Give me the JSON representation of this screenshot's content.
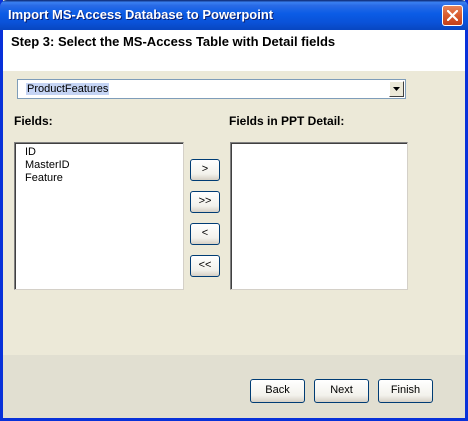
{
  "window": {
    "title": "Import MS-Access Database to Powerpoint"
  },
  "header": {
    "step_text": "Step 3:  Select the MS-Access Table with Detail fields"
  },
  "table_select": {
    "selected_value": "ProductFeatures"
  },
  "fields": {
    "label": "Fields:",
    "items": [
      "ID",
      "MasterID",
      "Feature"
    ]
  },
  "ppt_fields": {
    "label": "Fields in PPT Detail:",
    "items": []
  },
  "transfer_buttons": {
    "add_one": ">",
    "add_all": ">>",
    "remove_one": "<",
    "remove_all": "<<"
  },
  "footer": {
    "back_label": "Back",
    "next_label": "Next",
    "finish_label": "Finish"
  },
  "colors": {
    "title_bar": "#0a52d8",
    "close_button": "#d95b2e",
    "selection_highlight": "#c5d4f4",
    "dialog_background": "#ece9d8"
  }
}
